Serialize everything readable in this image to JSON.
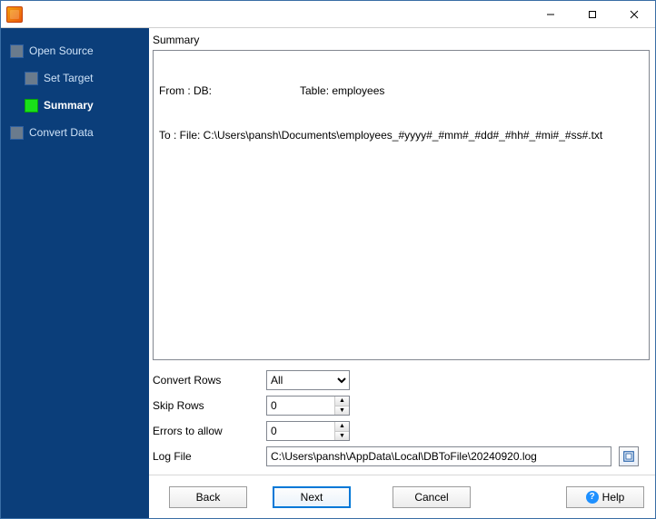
{
  "titlebar": {
    "title": ""
  },
  "sidebar": {
    "items": [
      {
        "label": "Open Source"
      },
      {
        "label": "Set Target"
      },
      {
        "label": "Summary"
      },
      {
        "label": "Convert Data"
      }
    ],
    "active_index": 2
  },
  "summary": {
    "heading": "Summary",
    "from_prefix": "From : DB:",
    "from_table_label": "Table: employees",
    "to_line": "To : File: C:\\Users\\pansh\\Documents\\employees_#yyyy#_#mm#_#dd#_#hh#_#mi#_#ss#.txt"
  },
  "form": {
    "convert_rows": {
      "label": "Convert Rows",
      "value": "All",
      "options": [
        "All"
      ]
    },
    "skip_rows": {
      "label": "Skip Rows",
      "value": "0"
    },
    "errors_to_allow": {
      "label": "Errors to allow",
      "value": "0"
    },
    "log_file": {
      "label": "Log File",
      "value": "C:\\Users\\pansh\\AppData\\Local\\DBToFile\\20240920.log"
    }
  },
  "buttons": {
    "back": "Back",
    "next": "Next",
    "cancel": "Cancel",
    "help": "Help"
  }
}
